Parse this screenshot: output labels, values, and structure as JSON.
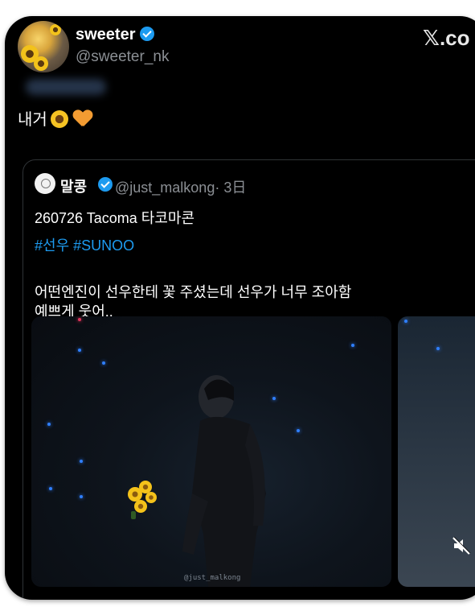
{
  "author": {
    "display_name": "sweeter",
    "handle": "@sweeter_nk"
  },
  "brand": {
    "label": "𝕏.co"
  },
  "tweet": {
    "text": "내거",
    "emojis": [
      "sunflower-icon",
      "orange-heart-icon"
    ]
  },
  "quote": {
    "display_name": "말콩",
    "handle": "@just_malkong",
    "time": "· 3日",
    "line1": "260726 Tacoma 타코마콘",
    "hashtags": "#선우 #SUNOO",
    "line2": "어떤엔진이 선우한테 꽃 주셨는데 선우가 너무 조아함",
    "line3": "예쁘게 웃어..",
    "media": {
      "watermark": "@just_malkong",
      "mute_icon": "mute-icon"
    }
  },
  "colors": {
    "background": "#000000",
    "accent": "#1d9bf0",
    "muted": "#8b8f94"
  }
}
